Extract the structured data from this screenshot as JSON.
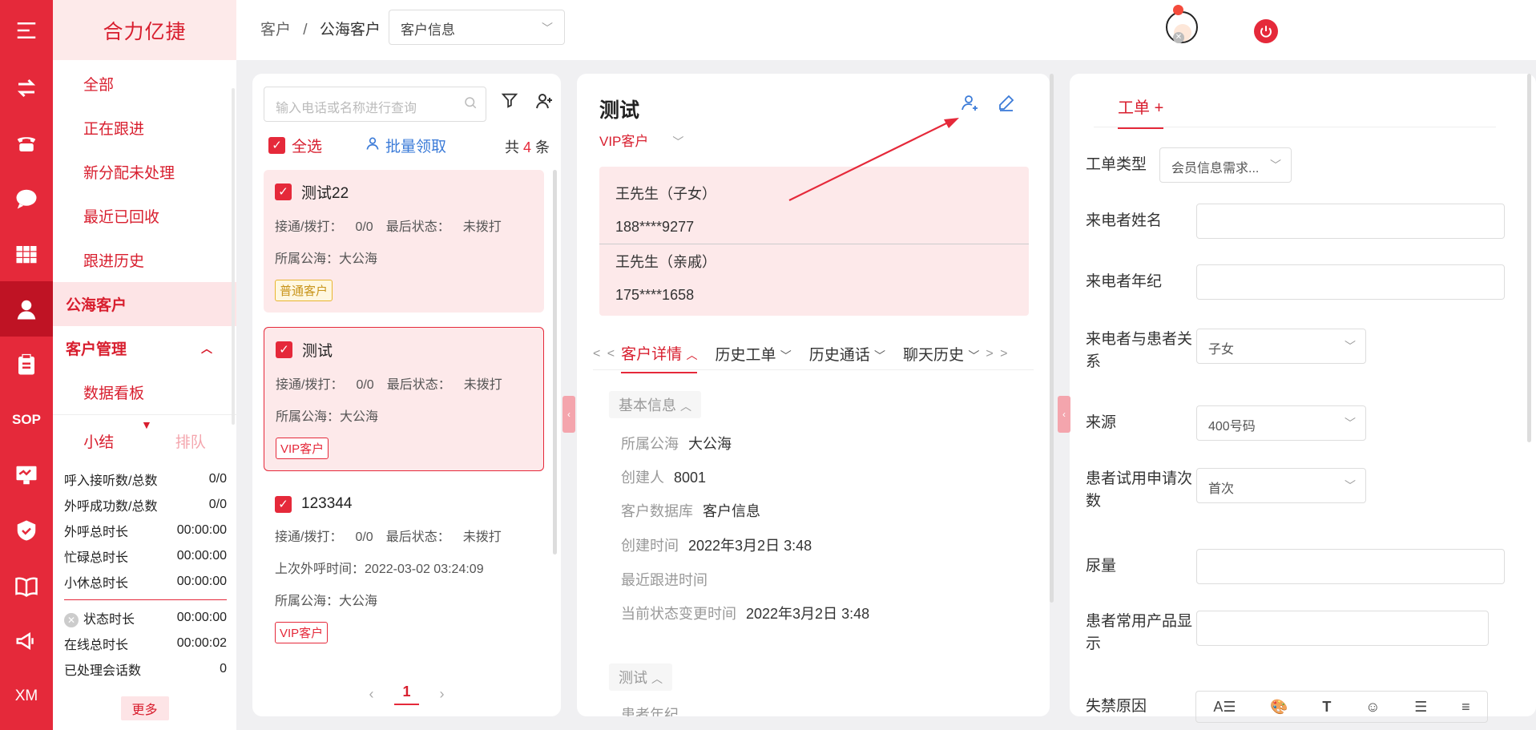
{
  "brand": "合力亿捷",
  "nav": {
    "items": [
      "全部",
      "正在跟进",
      "新分配未处理",
      "最近已回收",
      "跟进历史"
    ],
    "public_customers": "公海客户",
    "customer_mgmt": "客户管理",
    "dashboard": "数据看板",
    "rail_icons": [
      "menu-icon",
      "transfer-icon",
      "phone-icon",
      "chat-icon",
      "grid-icon",
      "customer-icon",
      "clipboard-icon",
      "sop-icon",
      "monitor-icon",
      "shield-icon",
      "book-icon",
      "megaphone-icon",
      "xm-icon"
    ],
    "sop_label": "SOP",
    "xm_label": "XM"
  },
  "summary": {
    "tab_summary": "小结",
    "tab_queue": "排队",
    "stats": [
      {
        "label": "呼入接听数/总数",
        "value": "0/0"
      },
      {
        "label": "外呼成功数/总数",
        "value": "0/0"
      },
      {
        "label": "外呼总时长",
        "value": "00:00:00"
      },
      {
        "label": "忙碌总时长",
        "value": "00:00:00"
      },
      {
        "label": "小休总时长",
        "value": "00:00:00"
      }
    ],
    "stats2": [
      {
        "label": "状态时长",
        "value": "00:00:00"
      },
      {
        "label": "在线总时长",
        "value": "00:00:02"
      },
      {
        "label": "已处理会话数",
        "value": "0"
      }
    ],
    "more": "更多"
  },
  "header": {
    "breadcrumb_root": "客户",
    "breadcrumb_sep": "/",
    "breadcrumb_current": "公海客户",
    "db_select": "客户信息"
  },
  "list": {
    "search_placeholder": "输入电话或名称进行查询",
    "select_all": "全选",
    "batch_claim": "批量领取",
    "count_prefix": "共",
    "count": "4",
    "count_suffix": "条",
    "page": "1",
    "cards": [
      {
        "name": "测试22",
        "calls_label": "接通/拨打：",
        "calls": "0/0",
        "status_label": "最后状态：",
        "status": "未拨打",
        "pool_label": "所属公海：",
        "pool": "大公海",
        "tag": "普通客户"
      },
      {
        "name": "测试",
        "calls_label": "接通/拨打：",
        "calls": "0/0",
        "status_label": "最后状态：",
        "status": "未拨打",
        "pool_label": "所属公海：",
        "pool": "大公海",
        "tag": "VIP客户"
      },
      {
        "name": "123344",
        "calls_label": "接通/拨打：",
        "calls": "0/0",
        "status_label": "最后状态：",
        "status": "未拨打",
        "last_call_label": "上次外呼时间：",
        "last_call": "2022-03-02 03:24:09",
        "pool_label": "所属公海：",
        "pool": "大公海",
        "tag": "VIP客户"
      }
    ]
  },
  "detail": {
    "name": "测试",
    "level": "VIP客户",
    "contacts": [
      {
        "name": "王先生（子女）",
        "phone": "188****9277"
      },
      {
        "name": "王先生（亲戚）",
        "phone": "175****1658"
      }
    ],
    "tab_prev": "< <",
    "tab_next": "> >",
    "tabs": [
      "客户详情",
      "历史工单",
      "历史通话",
      "聊天历史"
    ],
    "section_basic": "基本信息",
    "fields": [
      {
        "label": "所属公海",
        "value": "大公海"
      },
      {
        "label": "创建人",
        "value": "8001"
      },
      {
        "label": "客户数据库",
        "value": "客户信息"
      },
      {
        "label": "创建时间",
        "value": "2022年3月2日 3:48"
      },
      {
        "label": "最近跟进时间",
        "value": ""
      },
      {
        "label": "当前状态变更时间",
        "value": "2022年3月2日 3:48"
      }
    ],
    "section_test": "测试",
    "partial_field": "患者年纪"
  },
  "workorder": {
    "tab": "工单",
    "add": "+",
    "type_label": "工单类型",
    "type_value": "会员信息需求...",
    "fields": {
      "caller_name": "来电者姓名",
      "caller_age": "来电者年纪",
      "relation": "来电者与患者关系",
      "relation_value": "子女",
      "source": "来源",
      "source_value": "400号码",
      "trial_times": "患者试用申请次数",
      "trial_value": "首次",
      "urine": "尿量",
      "common_product": "患者常用产品显示",
      "incontinence": "失禁原因"
    }
  }
}
